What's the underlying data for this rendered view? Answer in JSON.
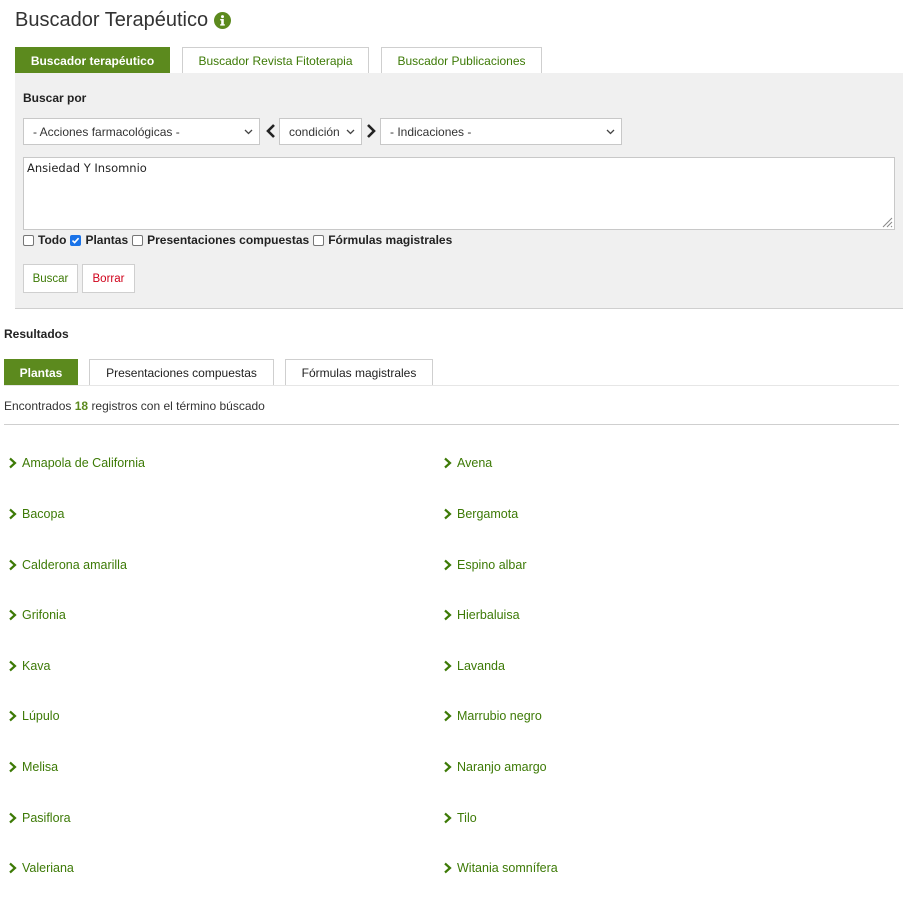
{
  "title": "Buscador Terapéutico",
  "top_tabs": [
    "Buscador terapéutico",
    "Buscador Revista Fitoterapia",
    "Buscador Publicaciones"
  ],
  "search": {
    "label": "Buscar por",
    "acciones_select": "- Acciones farmacológicas -",
    "condicion_select": "condición",
    "indicaciones_select": "- Indicaciones -",
    "query": "Ansiedad Y Insomnio",
    "filters": [
      {
        "label": "Todo",
        "checked": false
      },
      {
        "label": "Plantas",
        "checked": true
      },
      {
        "label": "Presentaciones compuestas",
        "checked": false
      },
      {
        "label": "Fórmulas magistrales",
        "checked": false
      }
    ],
    "search_button": "Buscar",
    "clear_button": "Borrar"
  },
  "results": {
    "heading": "Resultados",
    "tabs": [
      "Plantas",
      "Presentaciones compuestas",
      "Fórmulas magistrales"
    ],
    "found_prefix": "Encontrados",
    "found_count": "18",
    "found_suffix": "registros con el término búscado",
    "items": [
      "Amapola de California",
      "Avena",
      "Bacopa",
      "Bergamota",
      "Calderona amarilla",
      "Espino albar",
      "Grifonia",
      "Hierbaluisa",
      "Kava",
      "Lavanda",
      "Lúpulo",
      "Marrubio negro",
      "Melisa",
      "Naranjo amargo",
      "Pasiflora",
      "Tilo",
      "Valeriana",
      "Witania somnífera"
    ]
  },
  "colors": {
    "accent": "#5c8a1e",
    "link": "#3d7a06",
    "danger": "#d0021b",
    "panel": "#f0f0f0"
  }
}
